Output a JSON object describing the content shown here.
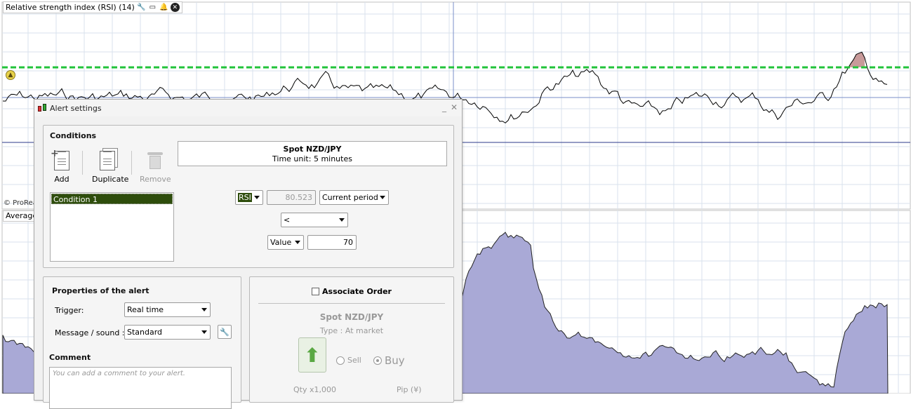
{
  "indicator": {
    "rsi_title": "Relative strength index (RSI) (14)",
    "copyright": "© ProReal",
    "average_title": "Average"
  },
  "colors": {
    "rsi_line": "#000000",
    "threshold_line": "#22c33a",
    "overbought_fill": "#c89a9a",
    "volume_fill": "#a9a9d6",
    "grid": "#d9e2ec",
    "condition_selected": "#2e4d0c"
  },
  "dialog": {
    "title": "Alert settings",
    "conditions": {
      "label": "Conditions",
      "tools": {
        "add": "Add",
        "duplicate": "Duplicate",
        "remove": "Remove"
      },
      "instrument": {
        "name": "Spot NZD/JPY",
        "time_unit": "Time unit: 5 minutes"
      },
      "list": [
        "Condition 1"
      ],
      "indicator_select": "RSI",
      "indicator_value": "80.523",
      "period_select": "Current period",
      "operator_select": "<",
      "compare_select": "Value",
      "compare_value": "70"
    },
    "properties": {
      "label": "Properties of the alert",
      "trigger_label": "Trigger:",
      "trigger_value": "Real time",
      "message_label": "Message / sound :",
      "message_value": "Standard",
      "comment_label": "Comment",
      "comment_placeholder": "You can add a comment to your alert."
    },
    "order": {
      "associate_label": "Associate Order",
      "instrument": "Spot NZD/JPY",
      "type": "Type : At market",
      "sell_label": "Sell",
      "buy_label": "Buy",
      "qty_label": "Qty x1,000",
      "pip_label": "Pip (¥)"
    }
  }
}
